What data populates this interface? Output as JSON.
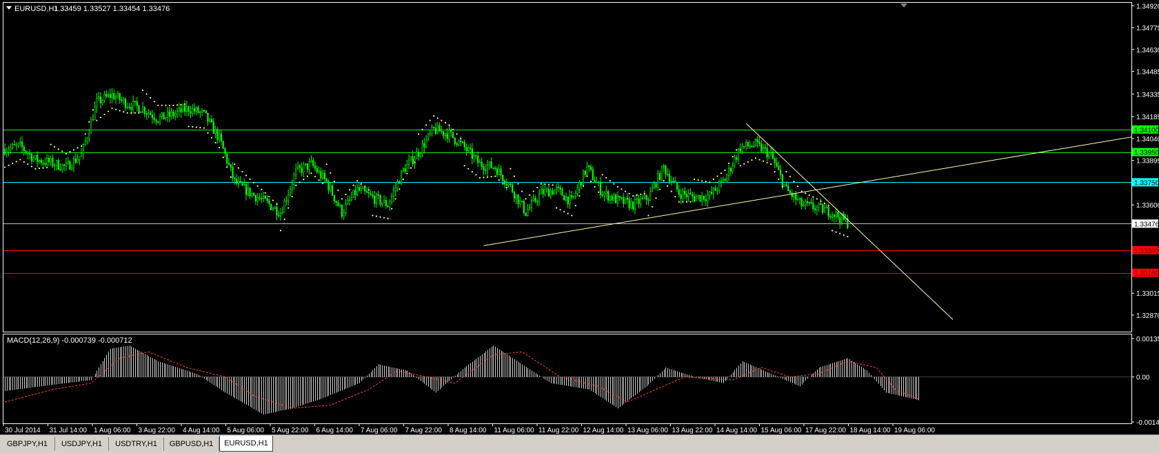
{
  "main_header": {
    "symbol": "EURUSD,H1",
    "ohlc": "1.33459 1.33527 1.33454 1.33476"
  },
  "macd_header": {
    "label": "MACD(12,26,9) -0.000739 -0.000712"
  },
  "colors": {
    "background": "#000000",
    "frame": "#ffffff",
    "candles": "#00ff00",
    "sar": "#ffff99",
    "trendline": "#ffffaa",
    "green_level": "#00ff00",
    "blue_level": "#00ffff",
    "red_level": "#ff0000",
    "bid_line": "#c0c0c0",
    "macd_hist": "#d0d0d0",
    "macd_signal": "#ff4040"
  },
  "price_levels": [
    {
      "price": "1.34100",
      "kind": "green"
    },
    {
      "price": "1.33950",
      "kind": "green"
    },
    {
      "price": "1.33750",
      "kind": "blue"
    },
    {
      "price": "1.33476",
      "kind": "bid"
    },
    {
      "price": "1.33300",
      "kind": "red"
    },
    {
      "price": "1.33150",
      "kind": "red"
    }
  ],
  "tabs": [
    "GBPJPY,H1",
    "USDJPY,H1",
    "USDTRY,H1",
    "GBPUSD,H1",
    "EURUSD,H1"
  ],
  "active_tab": "EURUSD,H1",
  "chart_data": [
    {
      "type": "candlestick",
      "title": "EURUSD,H1",
      "ylim": [
        1.3276,
        1.3494
      ],
      "y_ticks": [
        "1.34920",
        "1.34775",
        "1.34630",
        "1.34485",
        "1.34335",
        "1.34185",
        "1.34040",
        "1.33895",
        "1.33600",
        "1.33300",
        "1.33015",
        "1.32870"
      ],
      "x_ticks": [
        "30 Jul 2014",
        "31 Jul 14:00",
        "1 Aug 06:00",
        "3 Aug 22:00",
        "4 Aug 14:00",
        "5 Aug 06:00",
        "5 Aug 22:00",
        "6 Aug 14:00",
        "7 Aug 06:00",
        "7 Aug 22:00",
        "8 Aug 14:00",
        "11 Aug 06:00",
        "11 Aug 22:00",
        "12 Aug 14:00",
        "13 Aug 06:00",
        "13 Aug 22:00",
        "14 Aug 14:00",
        "15 Aug 06:00",
        "17 Aug 22:00",
        "18 Aug 14:00",
        "19 Aug 06:00"
      ],
      "series_close_by_bar": [
        [
          0,
          1.3397
        ],
        [
          8,
          1.3399
        ],
        [
          16,
          1.339
        ],
        [
          24,
          1.3388
        ],
        [
          32,
          1.3385
        ],
        [
          40,
          1.3393
        ],
        [
          48,
          1.3428
        ],
        [
          56,
          1.3433
        ],
        [
          64,
          1.3427
        ],
        [
          72,
          1.3424
        ],
        [
          80,
          1.3417
        ],
        [
          88,
          1.342
        ],
        [
          96,
          1.3424
        ],
        [
          104,
          1.342
        ],
        [
          112,
          1.3404
        ],
        [
          120,
          1.3375
        ],
        [
          128,
          1.3368
        ],
        [
          136,
          1.3362
        ],
        [
          144,
          1.3355
        ],
        [
          152,
          1.3382
        ],
        [
          160,
          1.3387
        ],
        [
          168,
          1.3375
        ],
        [
          176,
          1.3355
        ],
        [
          184,
          1.337
        ],
        [
          192,
          1.3365
        ],
        [
          200,
          1.336
        ],
        [
          208,
          1.3383
        ],
        [
          216,
          1.3395
        ],
        [
          224,
          1.341
        ],
        [
          232,
          1.3407
        ],
        [
          240,
          1.3398
        ],
        [
          248,
          1.3387
        ],
        [
          256,
          1.3385
        ],
        [
          264,
          1.3372
        ],
        [
          272,
          1.3355
        ],
        [
          280,
          1.3368
        ],
        [
          288,
          1.337
        ],
        [
          296,
          1.3362
        ],
        [
          304,
          1.3385
        ],
        [
          312,
          1.3368
        ],
        [
          320,
          1.3363
        ],
        [
          328,
          1.336
        ],
        [
          336,
          1.3365
        ],
        [
          344,
          1.3385
        ],
        [
          352,
          1.3368
        ],
        [
          360,
          1.3365
        ],
        [
          368,
          1.3366
        ],
        [
          376,
          1.3377
        ],
        [
          384,
          1.3398
        ],
        [
          392,
          1.34
        ],
        [
          400,
          1.3393
        ],
        [
          408,
          1.337
        ],
        [
          416,
          1.336
        ],
        [
          424,
          1.3358
        ],
        [
          432,
          1.3355
        ],
        [
          440,
          1.3348
        ]
      ],
      "annotations": [
        "ascending trendline",
        "descending trendline",
        "parabolic SAR"
      ]
    },
    {
      "type": "bar",
      "title": "MACD(12,26,9) -0.000739 -0.000712",
      "ylim": [
        -0.00148,
        0.001355
      ],
      "y_ticks": [
        "0.001355",
        "0.00",
        "-0.00148"
      ],
      "series": [
        {
          "name": "MACD",
          "values_by_bar": [
            [
              0,
              -0.00045
            ],
            [
              25,
              -0.00025
            ],
            [
              45,
              -0.0001
            ],
            [
              55,
              0.0009
            ],
            [
              65,
              0.001
            ],
            [
              80,
              0.0005
            ],
            [
              100,
              0.0001
            ],
            [
              115,
              -0.0005
            ],
            [
              135,
              -0.0012
            ],
            [
              150,
              -0.001
            ],
            [
              165,
              -0.0007
            ],
            [
              185,
              -0.0002
            ],
            [
              195,
              0.0004
            ],
            [
              210,
              0.0002
            ],
            [
              225,
              -0.0005
            ],
            [
              240,
              0.0003
            ],
            [
              255,
              0.001
            ],
            [
              270,
              0.0004
            ],
            [
              285,
              -0.0002
            ],
            [
              305,
              -0.0004
            ],
            [
              320,
              -0.001
            ],
            [
              335,
              -0.0003
            ],
            [
              345,
              0.0003
            ],
            [
              360,
              0.0
            ],
            [
              375,
              -0.0002
            ],
            [
              385,
              0.0005
            ],
            [
              400,
              0.0001
            ],
            [
              415,
              -0.0003
            ],
            [
              425,
              0.0003
            ],
            [
              440,
              0.0006
            ],
            [
              450,
              0.0002
            ],
            [
              460,
              -0.0005
            ],
            [
              477,
              -0.00074
            ]
          ]
        },
        {
          "name": "Signal",
          "values_by_bar": [
            [
              0,
              -0.0008
            ],
            [
              25,
              -0.0004
            ],
            [
              45,
              -0.0002
            ],
            [
              60,
              0.0006
            ],
            [
              75,
              0.0008
            ],
            [
              95,
              0.0003
            ],
            [
              115,
              0.0
            ],
            [
              130,
              -0.0006
            ],
            [
              150,
              -0.001
            ],
            [
              170,
              -0.0009
            ],
            [
              190,
              -0.0004
            ],
            [
              205,
              0.0002
            ],
            [
              220,
              0.0
            ],
            [
              235,
              -0.0002
            ],
            [
              255,
              0.0007
            ],
            [
              270,
              0.0008
            ],
            [
              290,
              0.0
            ],
            [
              310,
              -0.0003
            ],
            [
              325,
              -0.0008
            ],
            [
              340,
              -0.0004
            ],
            [
              355,
              0.0
            ],
            [
              380,
              -0.0001
            ],
            [
              395,
              0.0003
            ],
            [
              410,
              0.0
            ],
            [
              425,
              0.0001
            ],
            [
              440,
              0.0005
            ],
            [
              455,
              0.0003
            ],
            [
              465,
              -0.0004
            ],
            [
              477,
              -0.00071
            ]
          ]
        }
      ]
    }
  ]
}
